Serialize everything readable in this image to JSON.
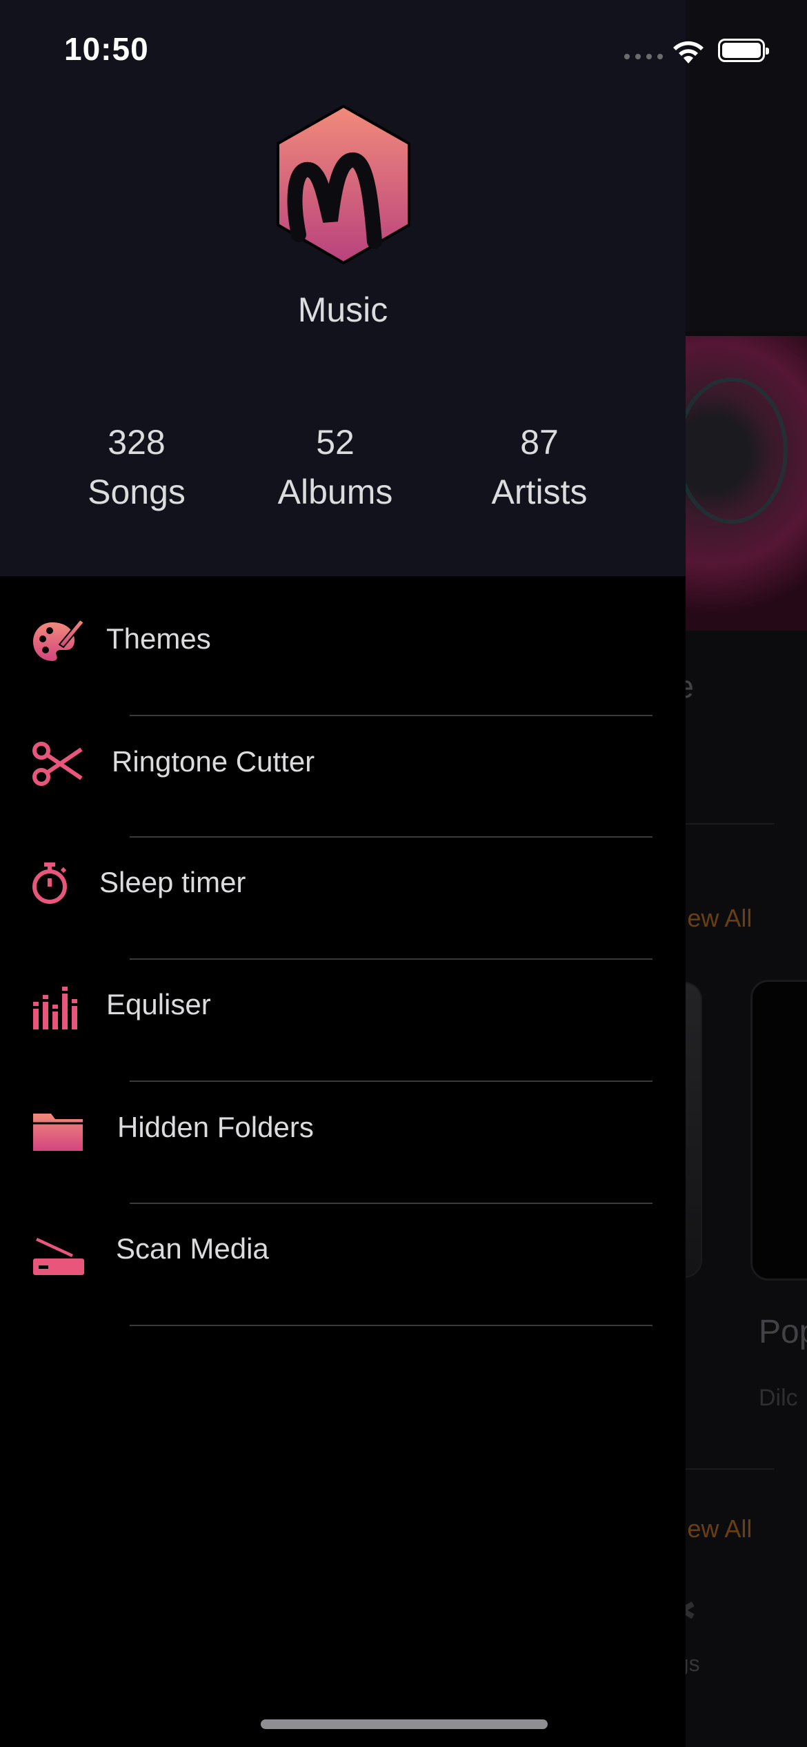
{
  "status_bar": {
    "time": "10:50"
  },
  "drawer": {
    "app_name": "Music",
    "stats": [
      {
        "value": "328",
        "label": "Songs"
      },
      {
        "value": "52",
        "label": "Albums"
      },
      {
        "value": "87",
        "label": "Artists"
      }
    ],
    "menu": [
      {
        "label": "Themes",
        "icon": "palette-icon"
      },
      {
        "label": "Ringtone Cutter",
        "icon": "scissors-icon"
      },
      {
        "label": "Sleep timer",
        "icon": "stopwatch-icon"
      },
      {
        "label": "Equliser",
        "icon": "equalizer-icon"
      },
      {
        "label": "Hidden Folders",
        "icon": "folder-icon"
      },
      {
        "label": "Scan Media",
        "icon": "scanner-icon"
      }
    ]
  },
  "background": {
    "section_text_partial": "re",
    "view_all_1": "View All",
    "view_all_2": "View All",
    "card_title_partial": "Pop",
    "card_subtitle_partial": "Dilc",
    "bottom_label_partial": "ngs"
  },
  "colors": {
    "accent_gradient_start": "#f08a7a",
    "accent_gradient_end": "#c6407f",
    "drawer_header_bg": "#11121b",
    "drawer_bg": "#000000",
    "view_all_color": "#a8661c"
  }
}
